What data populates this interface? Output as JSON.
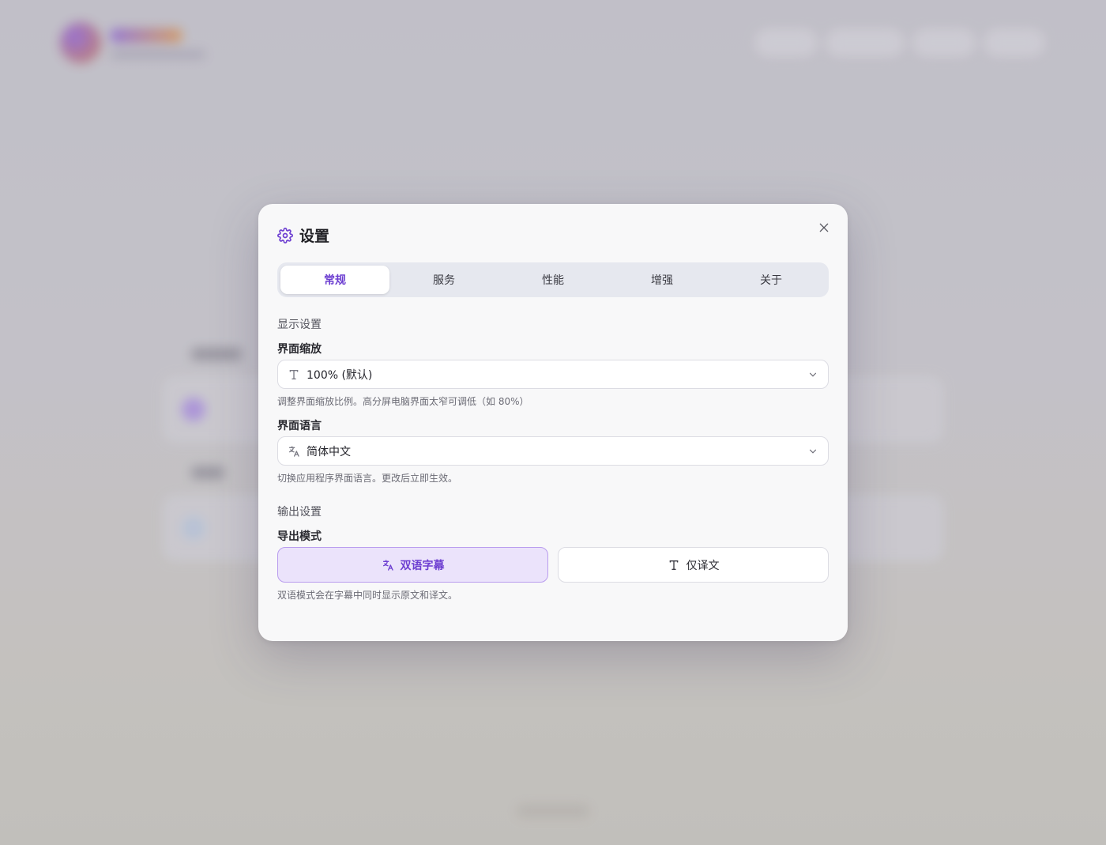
{
  "colors": {
    "accent": "#6d3fd1",
    "selected_bg": "#ebe3fb",
    "modal_bg": "#f8f8f9"
  },
  "modal": {
    "title": "设置",
    "icon": "gear-icon",
    "close_icon": "close-icon"
  },
  "tabs": [
    {
      "label": "常规",
      "active": true
    },
    {
      "label": "服务",
      "active": false
    },
    {
      "label": "性能",
      "active": false
    },
    {
      "label": "增强",
      "active": false
    },
    {
      "label": "关于",
      "active": false
    }
  ],
  "display_settings": {
    "section_title": "显示设置",
    "scale": {
      "label": "界面缩放",
      "icon": "text-size-icon",
      "value": "100% (默认)",
      "hint": "调整界面缩放比例。高分屏电脑界面太窄可调低（如 80%）"
    },
    "language": {
      "label": "界面语言",
      "icon": "translate-icon",
      "value": "简体中文",
      "hint": "切换应用程序界面语言。更改后立即生效。"
    }
  },
  "output_settings": {
    "section_title": "输出设置",
    "export_mode": {
      "label": "导出模式",
      "options": [
        {
          "label": "双语字幕",
          "icon": "translate-icon",
          "selected": true
        },
        {
          "label": "仅译文",
          "icon": "text-icon",
          "selected": false
        }
      ],
      "hint": "双语模式会在字幕中同时显示原文和译文。"
    }
  }
}
